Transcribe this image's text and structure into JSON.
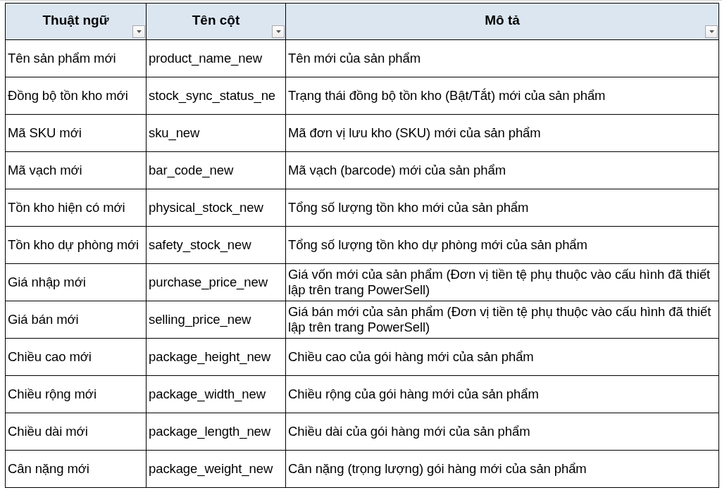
{
  "table": {
    "columns": [
      {
        "label": "Thuật ngữ",
        "filter": true
      },
      {
        "label": "Tên cột",
        "filter": true
      },
      {
        "label": "Mô tả",
        "filter": true
      }
    ],
    "rows": [
      [
        "Tên sản phẩm mới",
        "product_name_new",
        "Tên mới của sản phẩm"
      ],
      [
        "Đồng bộ tồn kho mới",
        "stock_sync_status_ne",
        "Trạng thái đồng bộ tồn kho (Bật/Tắt) mới của sản phẩm"
      ],
      [
        "Mã SKU mới",
        "sku_new",
        "Mã đơn vị lưu kho (SKU) mới của sản phẩm"
      ],
      [
        "Mã vạch mới",
        "bar_code_new",
        "Mã vạch (barcode) mới của sản phẩm"
      ],
      [
        "Tồn kho hiện có mới",
        "physical_stock_new",
        "Tổng số lượng tồn kho mới của sản phẩm"
      ],
      [
        "Tồn kho dự phòng mới",
        "safety_stock_new",
        "Tổng số lượng tồn kho dự phòng mới của sản phẩm"
      ],
      [
        "Giá nhập mới",
        "purchase_price_new",
        "Giá vốn mới của sản phẩm (Đơn vị tiền tệ phụ thuộc vào cấu hình đã thiết lập trên trang PowerSell)"
      ],
      [
        "Giá bán mới",
        "selling_price_new",
        "Giá bán mới của sản phẩm (Đơn vị tiền tệ phụ thuộc vào cấu hình đã thiết lập trên trang PowerSell)"
      ],
      [
        "Chiều cao mới",
        "package_height_new",
        "Chiều cao của gói hàng mới của sản phẩm"
      ],
      [
        "Chiều rộng mới",
        "package_width_new",
        "Chiều rộng của gói hàng mới của sản phẩm"
      ],
      [
        "Chiều dài mới",
        "package_length_new",
        "Chiều dài của gói hàng mới của sản phẩm"
      ],
      [
        "Cân nặng mới",
        "package_weight_new",
        "Cân nặng (trọng lượng) gói hàng mới của sản phẩm"
      ]
    ]
  }
}
